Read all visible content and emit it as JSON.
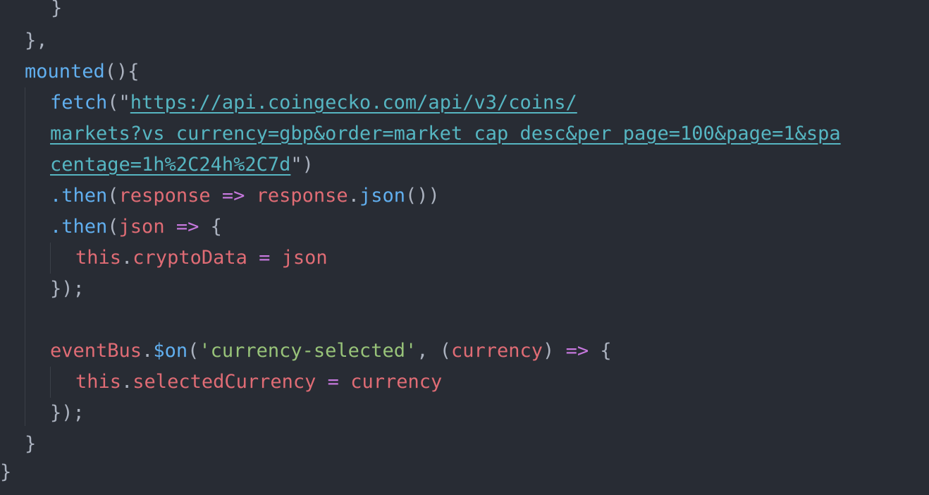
{
  "editor": {
    "language": "javascript",
    "theme": "One Dark",
    "colors": {
      "background": "#282c34",
      "punctuation": "#abb2bf",
      "function": "#61afef",
      "variable": "#e06c75",
      "keyword": "#c678dd",
      "string": "#98c379",
      "link": "#56b6c2"
    },
    "lines": [
      {
        "t": [
          {
            "k": "punc",
            "v": "}"
          }
        ]
      },
      {
        "t": [
          {
            "k": "punc",
            "v": "},"
          }
        ]
      },
      {
        "t": [
          {
            "k": "fn",
            "v": "mounted"
          },
          {
            "k": "punc",
            "v": "(){"
          }
        ]
      },
      {
        "t": [
          {
            "k": "fn",
            "v": "fetch"
          },
          {
            "k": "punc",
            "v": "(\""
          },
          {
            "k": "link",
            "v": "https://api.coingecko.com/api/v3/coins/"
          }
        ]
      },
      {
        "t": [
          {
            "k": "link",
            "v": "markets?vs_currency=gbp&order=market_cap_desc&per_page=100&page=1&spa"
          }
        ]
      },
      {
        "t": [
          {
            "k": "link",
            "v": "centage=1h%2C24h%2C7d"
          },
          {
            "k": "punc",
            "v": "\")"
          }
        ]
      },
      {
        "t": [
          {
            "k": "fn",
            "v": ".then"
          },
          {
            "k": "punc",
            "v": "("
          },
          {
            "k": "var",
            "v": "response"
          },
          {
            "k": "ws",
            "v": " "
          },
          {
            "k": "kw",
            "v": "=>"
          },
          {
            "k": "ws",
            "v": " "
          },
          {
            "k": "var",
            "v": "response"
          },
          {
            "k": "punc",
            "v": "."
          },
          {
            "k": "fn",
            "v": "json"
          },
          {
            "k": "punc",
            "v": "())"
          }
        ]
      },
      {
        "t": [
          {
            "k": "fn",
            "v": ".then"
          },
          {
            "k": "punc",
            "v": "("
          },
          {
            "k": "var",
            "v": "json"
          },
          {
            "k": "ws",
            "v": " "
          },
          {
            "k": "kw",
            "v": "=>"
          },
          {
            "k": "ws",
            "v": " "
          },
          {
            "k": "punc",
            "v": "{"
          }
        ]
      },
      {
        "t": [
          {
            "k": "var",
            "v": "this"
          },
          {
            "k": "punc",
            "v": "."
          },
          {
            "k": "var",
            "v": "cryptoData"
          },
          {
            "k": "ws",
            "v": " "
          },
          {
            "k": "kw",
            "v": "="
          },
          {
            "k": "ws",
            "v": " "
          },
          {
            "k": "var",
            "v": "json"
          }
        ]
      },
      {
        "t": [
          {
            "k": "punc",
            "v": "});"
          }
        ]
      },
      {
        "t": []
      },
      {
        "t": [
          {
            "k": "var",
            "v": "eventBus"
          },
          {
            "k": "punc",
            "v": "."
          },
          {
            "k": "fn",
            "v": "$on"
          },
          {
            "k": "punc",
            "v": "("
          },
          {
            "k": "str",
            "v": "'currency-selected'"
          },
          {
            "k": "punc",
            "v": ", ("
          },
          {
            "k": "var",
            "v": "currency"
          },
          {
            "k": "punc",
            "v": ")"
          },
          {
            "k": "ws",
            "v": " "
          },
          {
            "k": "kw",
            "v": "=>"
          },
          {
            "k": "ws",
            "v": " "
          },
          {
            "k": "punc",
            "v": "{"
          }
        ]
      },
      {
        "t": [
          {
            "k": "var",
            "v": "this"
          },
          {
            "k": "punc",
            "v": "."
          },
          {
            "k": "var",
            "v": "selectedCurrency"
          },
          {
            "k": "ws",
            "v": " "
          },
          {
            "k": "kw",
            "v": "="
          },
          {
            "k": "ws",
            "v": " "
          },
          {
            "k": "var",
            "v": "currency"
          }
        ]
      },
      {
        "t": [
          {
            "k": "punc",
            "v": "});"
          }
        ]
      },
      {
        "t": [
          {
            "k": "punc",
            "v": "}"
          }
        ]
      },
      {
        "t": [
          {
            "k": "punc",
            "v": "}"
          }
        ]
      }
    ]
  }
}
